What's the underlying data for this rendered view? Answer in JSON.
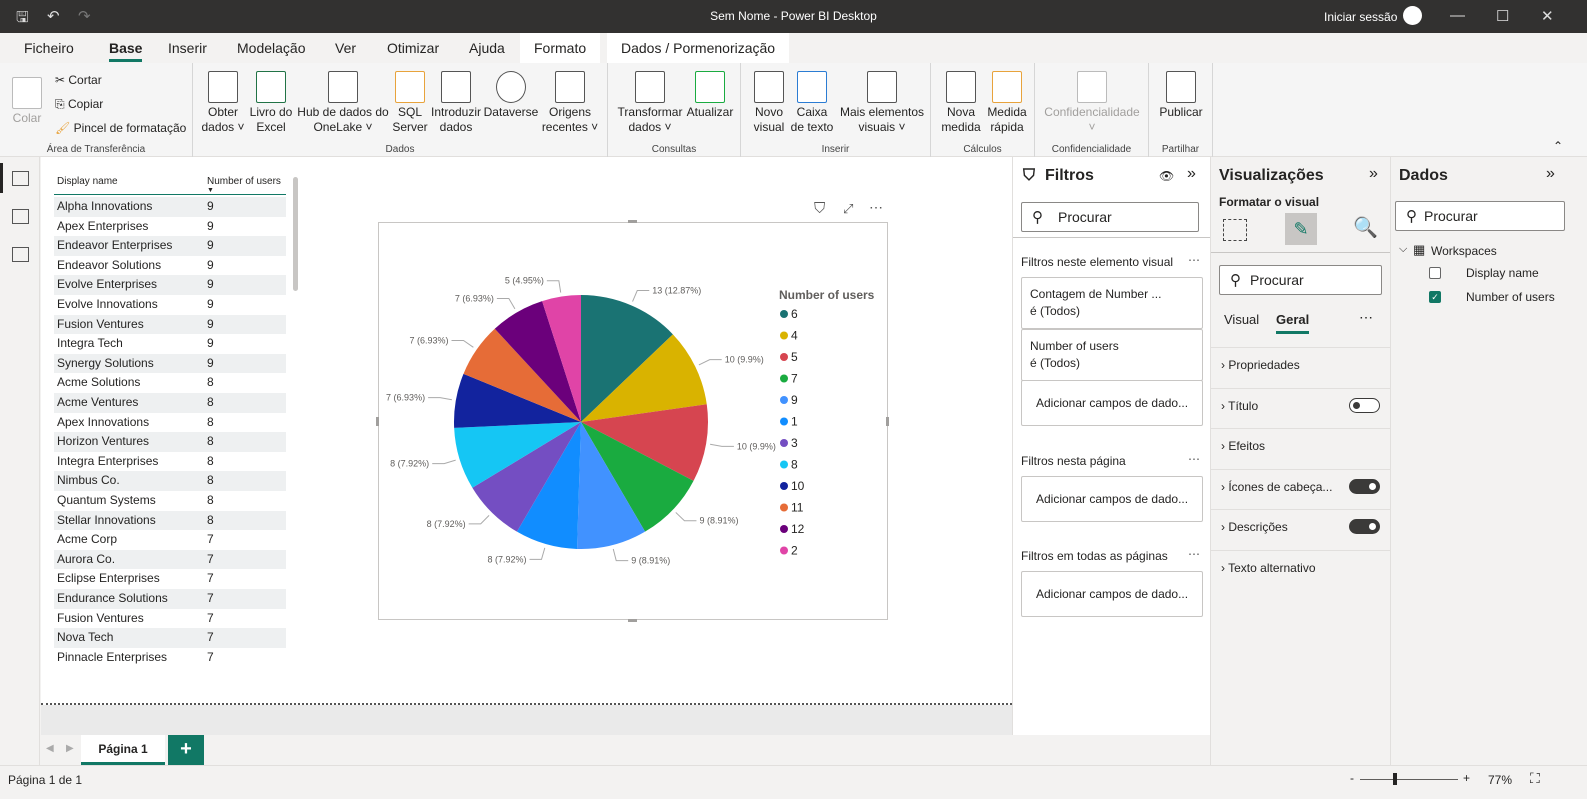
{
  "window": {
    "title": "Sem Nome - Power BI Desktop",
    "signin": "Iniciar sessão"
  },
  "menu": {
    "tabs": [
      "Ficheiro",
      "Base",
      "Inserir",
      "Modelação",
      "Ver",
      "Otimizar",
      "Ajuda",
      "Formato",
      "Dados / Pormenorização"
    ],
    "active": "Base"
  },
  "ribbon": {
    "clipboard": {
      "label": "Área de Transferência",
      "paste": "Colar",
      "cut": "Cortar",
      "copy": "Copiar",
      "format_painter": "Pincel de formatação"
    },
    "data": {
      "label": "Dados",
      "items": [
        "Obter dados ˅",
        "Livro do Excel",
        "Hub de dados do OneLake ˅",
        "SQL Server",
        "Introduzir dados",
        "Dataverse",
        "Origens recentes ˅"
      ]
    },
    "queries": {
      "label": "Consultas",
      "items": [
        "Transformar dados ˅",
        "Atualizar"
      ]
    },
    "insert": {
      "label": "Inserir",
      "items": [
        "Novo visual",
        "Caixa de texto",
        "Mais elementos visuais ˅"
      ]
    },
    "calc": {
      "label": "Cálculos",
      "items": [
        "Nova medida",
        "Medida rápida"
      ]
    },
    "sens": {
      "label": "Confidencialidade",
      "items": [
        "Confidencialidade ˅"
      ]
    },
    "share": {
      "label": "Partilhar",
      "items": [
        "Publicar"
      ]
    }
  },
  "table": {
    "headers": [
      "Display name",
      "Number of users"
    ],
    "rows": [
      [
        "Alpha Innovations",
        "9"
      ],
      [
        "Apex Enterprises",
        "9"
      ],
      [
        "Endeavor Enterprises",
        "9"
      ],
      [
        "Endeavor Solutions",
        "9"
      ],
      [
        "Evolve Enterprises",
        "9"
      ],
      [
        "Evolve Innovations",
        "9"
      ],
      [
        "Fusion Ventures",
        "9"
      ],
      [
        "Integra Tech",
        "9"
      ],
      [
        "Synergy Solutions",
        "9"
      ],
      [
        "Acme Solutions",
        "8"
      ],
      [
        "Acme Ventures",
        "8"
      ],
      [
        "Apex Innovations",
        "8"
      ],
      [
        "Horizon Ventures",
        "8"
      ],
      [
        "Integra Enterprises",
        "8"
      ],
      [
        "Nimbus Co.",
        "8"
      ],
      [
        "Quantum Systems",
        "8"
      ],
      [
        "Stellar Innovations",
        "8"
      ],
      [
        "Acme Corp",
        "7"
      ],
      [
        "Aurora Co.",
        "7"
      ],
      [
        "Eclipse Enterprises",
        "7"
      ],
      [
        "Endurance Solutions",
        "7"
      ],
      [
        "Fusion Ventures",
        "7"
      ],
      [
        "Nova Tech",
        "7"
      ],
      [
        "Pinnacle Enterprises",
        "7"
      ]
    ]
  },
  "chart_data": {
    "type": "pie",
    "legend_title": "Number of users",
    "legend_position": "right",
    "categories": [
      "6",
      "4",
      "5",
      "7",
      "9",
      "1",
      "3",
      "8",
      "10",
      "11",
      "12",
      "2"
    ],
    "values": [
      13,
      10,
      10,
      9,
      9,
      8,
      8,
      8,
      7,
      7,
      7,
      5
    ],
    "labels": [
      "13 (12.87%)",
      "10 (9.9%)",
      "10 (9.9%)",
      "9 (8.91%)",
      "9 (8.91%)",
      "8 (7.92%)",
      "8 (7.92%)",
      "8 (7.92%)",
      "7 (6.93%)",
      "7 (6.93%)",
      "7 (6.93%)",
      "5 (4.95%)"
    ],
    "colors": [
      "#1a7373",
      "#d9b300",
      "#d64550",
      "#1aab40",
      "#4192ff",
      "#118dff",
      "#744ec2",
      "#15c6f4",
      "#12239e",
      "#e66c37",
      "#6b007b",
      "#e044a7"
    ]
  },
  "filters": {
    "title": "Filtros",
    "search": "Procurar",
    "visual_section": "Filtros neste elemento visual",
    "cards": [
      [
        "Contagem de Number ...",
        "é (Todos)"
      ],
      [
        "Number of users",
        "é (Todos)"
      ]
    ],
    "add": "Adicionar campos de dado...",
    "page_section": "Filtros nesta página",
    "all_section": "Filtros em todas as páginas"
  },
  "viz": {
    "title": "Visualizações",
    "subtitle": "Formatar o visual",
    "search": "Procurar",
    "tabs": [
      "Visual",
      "Geral"
    ],
    "props": [
      "Propriedades",
      "Título",
      "Efeitos",
      "Ícones de cabeça...",
      "Descrições",
      "Texto alternativo"
    ],
    "toggles": {
      "Título": false,
      "Ícones de cabeça...": true,
      "Descrições": true
    }
  },
  "dados": {
    "title": "Dados",
    "search": "Procurar",
    "table": "Workspaces",
    "fields": [
      {
        "name": "Display name",
        "checked": false
      },
      {
        "name": "Number of users",
        "checked": true
      }
    ]
  },
  "pages": {
    "tab": "Página 1",
    "add": "+"
  },
  "status": {
    "page": "Página 1 de 1",
    "zoom": "77%"
  },
  "accent": "#117865"
}
